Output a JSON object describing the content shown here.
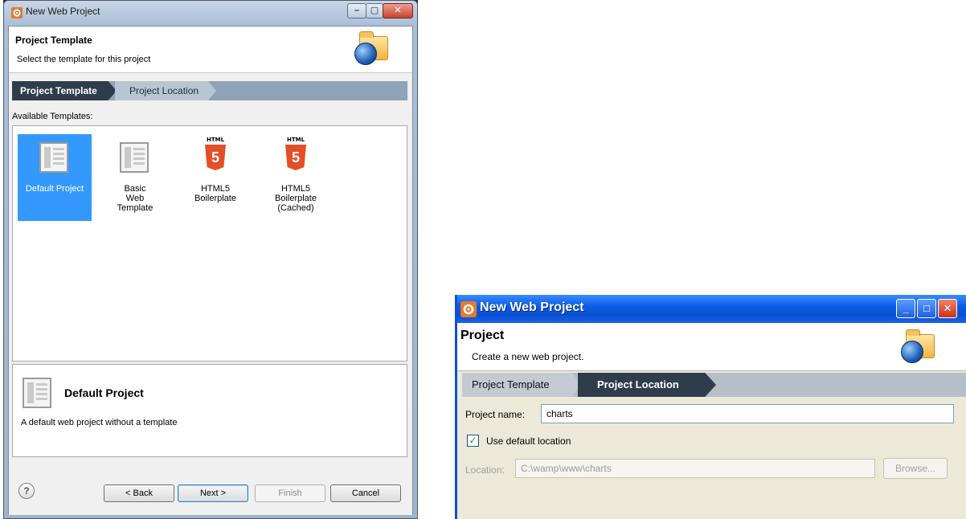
{
  "dialog1": {
    "title": "New Web Project",
    "header_title": "Project Template",
    "header_subtitle": "Select the template for this project",
    "steps": [
      "Project Template",
      "Project Location"
    ],
    "available_label": "Available Templates:",
    "templates": [
      {
        "label": "Default Project",
        "icon": "document-icon",
        "selected": true
      },
      {
        "label": "Basic Web Template",
        "icon": "document-icon",
        "selected": false
      },
      {
        "label": "HTML5 Boilerplate",
        "icon": "html5-icon",
        "selected": false
      },
      {
        "label": "HTML5 Boilerplate (Cached)",
        "icon": "html5-icon",
        "selected": false
      }
    ],
    "html5_badge": "HTML",
    "html5_digit": "5",
    "description_title": "Default Project",
    "description_text": "A default web project without a template",
    "help_glyph": "?",
    "buttons": {
      "back": "< Back",
      "next": "Next >",
      "finish": "Finish",
      "cancel": "Cancel"
    }
  },
  "dialog2": {
    "title": "New Web Project",
    "header_title": "Project",
    "header_subtitle": "Create a new web project.",
    "steps": [
      "Project Template",
      "Project Location"
    ],
    "project_name_label": "Project name:",
    "project_name_value": "charts",
    "use_default_label": "Use default location",
    "use_default_checked": true,
    "location_label": "Location:",
    "location_value": "C:\\wamp\\www\\charts",
    "browse_label": "Browse..."
  },
  "colors": {
    "selection": "#3399ff",
    "step_active": "#2f3c4c",
    "xp_titlebar": "#0a5ee6",
    "html5_orange": "#e34f26"
  }
}
